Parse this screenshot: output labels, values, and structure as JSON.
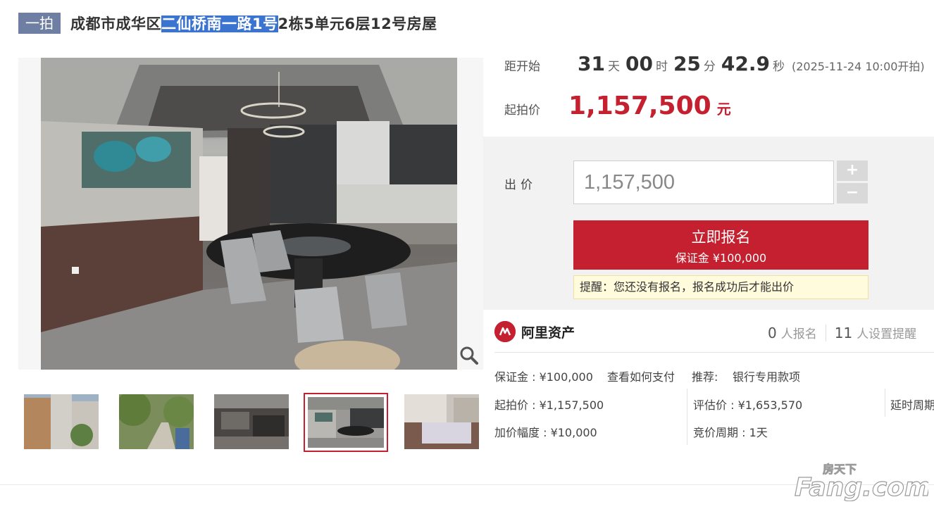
{
  "header": {
    "badge": "一拍",
    "title_prefix": "成都市成华区",
    "title_highlight": "二仙桥南一路1号",
    "title_suffix": "2栋5单元6层12号房屋"
  },
  "countdown": {
    "label": "距开始",
    "days": "31",
    "days_unit": "天",
    "hours": "00",
    "hours_unit": "时",
    "minutes": "25",
    "minutes_unit": "分",
    "seconds": "42.9",
    "seconds_unit": "秒",
    "start_text": "(2025-11-24 10:00开拍)"
  },
  "start_price": {
    "label": "起拍价",
    "value": "1,157,500",
    "unit": "元"
  },
  "bid": {
    "label": "出价",
    "value": "1,157,500",
    "plus": "+",
    "minus": "−",
    "register_label": "立即报名",
    "deposit_text": "保证金 ¥100,000",
    "tip": "提醒：您还没有报名，报名成功后才能出价"
  },
  "platform": {
    "name": "阿里资产",
    "signups": "0",
    "signups_label": "人报名",
    "reminders": "11",
    "reminders_label": "人设置提醒"
  },
  "info": {
    "deposit": "保证金 : ¥100,000",
    "how_to_pay": "查看如何支付",
    "recommend_label": "推荐:",
    "recommend_link": "银行专用款项",
    "start_price": "起拍价 : ¥1,157,500",
    "appraisal": "评估价 : ¥1,653,570",
    "delay": "延时周期",
    "increment": "加价幅度 : ¥10,000",
    "bid_period": "竞价周期 : 1天"
  },
  "watermark": {
    "top": "房天下",
    "main": "Fang.com"
  },
  "colors": {
    "accent": "#c4202f",
    "badge": "#6f7fa3",
    "link": "#3a6fb8",
    "highlight": "#3b73d1"
  }
}
